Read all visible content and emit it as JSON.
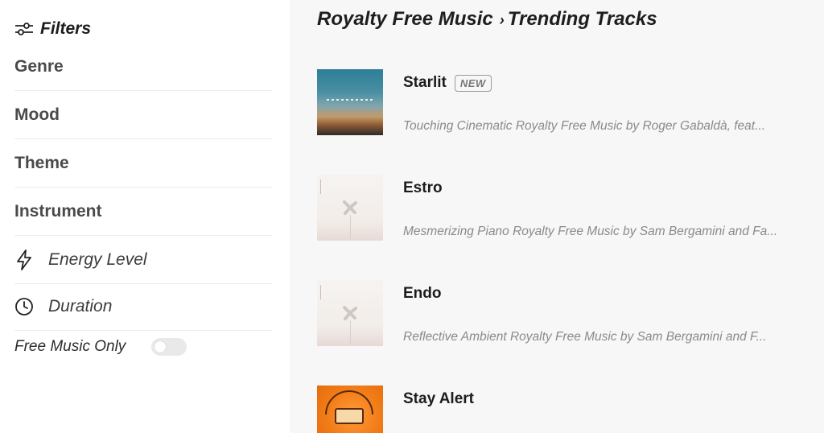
{
  "sidebar": {
    "filters_title": "Filters",
    "filters_icon": "sliders-icon",
    "items": [
      {
        "label": "Genre"
      },
      {
        "label": "Mood"
      },
      {
        "label": "Theme"
      },
      {
        "label": "Instrument"
      },
      {
        "label": "Energy Level",
        "icon": "lightning-icon"
      },
      {
        "label": "Duration",
        "icon": "clock-icon"
      }
    ],
    "free_music_label": "Free Music Only",
    "free_music_enabled": false
  },
  "main": {
    "breadcrumb": {
      "root": "Royalty Free Music",
      "separator": "›",
      "current": "Trending Tracks"
    },
    "tracks": [
      {
        "title": "Starlit",
        "badge": "NEW",
        "description": "Touching Cinematic Royalty Free Music by Roger Gabaldà, feat..."
      },
      {
        "title": "Estro",
        "badge": "",
        "description": "Mesmerizing Piano Royalty Free Music by Sam Bergamini and Fa..."
      },
      {
        "title": "Endo",
        "badge": "",
        "description": "Reflective Ambient Royalty Free Music by Sam Bergamini and F..."
      },
      {
        "title": "Stay Alert",
        "badge": "",
        "description": ""
      }
    ]
  },
  "colors": {
    "main_background": "#f7f7f7",
    "sidebar_background": "#ffffff",
    "description_text": "#8a8a8a"
  }
}
